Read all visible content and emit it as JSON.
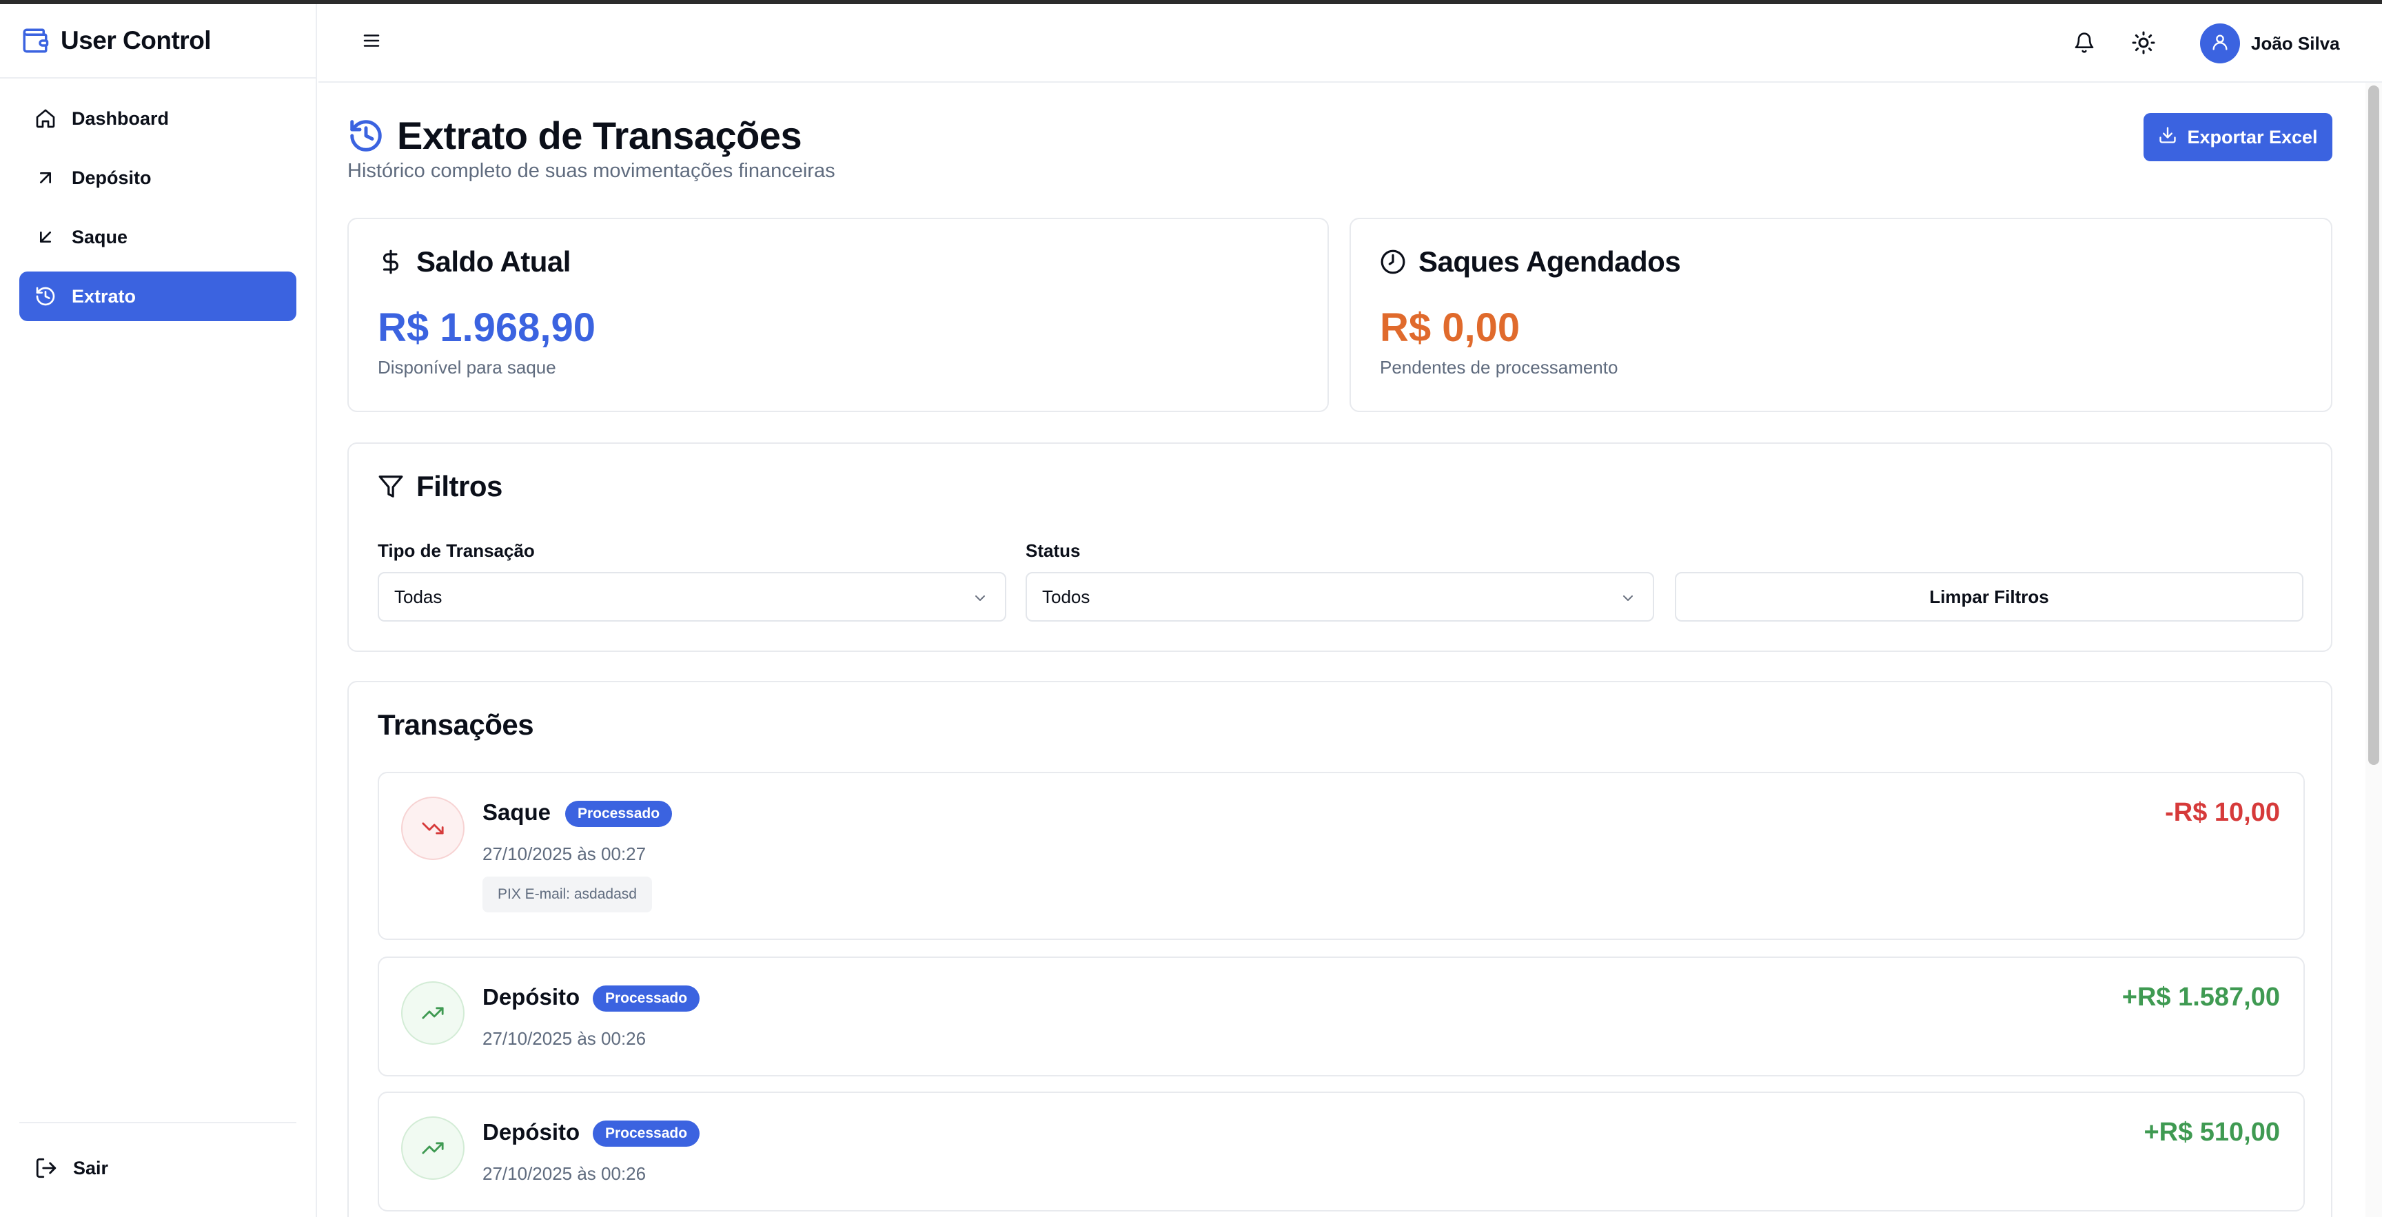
{
  "app": {
    "title": "User Control"
  },
  "sidebar": {
    "items": [
      {
        "label": "Dashboard",
        "icon": "home-icon"
      },
      {
        "label": "Depósito",
        "icon": "arrow-up-right-icon"
      },
      {
        "label": "Saque",
        "icon": "arrow-down-left-icon"
      },
      {
        "label": "Extrato",
        "icon": "history-icon",
        "active": true
      }
    ],
    "logout_label": "Sair"
  },
  "header": {
    "user_name": "João Silva"
  },
  "page": {
    "title": "Extrato de Transações",
    "subtitle": "Histórico completo de suas movimentações financeiras",
    "export_label": "Exportar Excel"
  },
  "balance": {
    "title": "Saldo Atual",
    "value": "R$ 1.968,90",
    "caption": "Disponível para saque"
  },
  "scheduled": {
    "title": "Saques Agendados",
    "value": "R$ 0,00",
    "caption": "Pendentes de processamento"
  },
  "filters": {
    "title": "Filtros",
    "type_label": "Tipo de Transação",
    "type_value": "Todas",
    "status_label": "Status",
    "status_value": "Todos",
    "clear_label": "Limpar Filtros"
  },
  "transactions": {
    "title": "Transações",
    "items": [
      {
        "name": "Saque",
        "status": "Processado",
        "date": "27/10/2025 às 00:27",
        "note": "PIX E-mail: asdadasd",
        "amount": "-R$ 10,00",
        "direction": "out"
      },
      {
        "name": "Depósito",
        "status": "Processado",
        "date": "27/10/2025 às 00:26",
        "amount": "+R$ 1.587,00",
        "direction": "in"
      },
      {
        "name": "Depósito",
        "status": "Processado",
        "date": "27/10/2025 às 00:26",
        "amount": "+R$ 510,00",
        "direction": "in"
      }
    ]
  },
  "colors": {
    "accent": "#3b63e0",
    "positive": "#3f9a52",
    "negative": "#d63a3a",
    "pending": "#e06a2c"
  }
}
